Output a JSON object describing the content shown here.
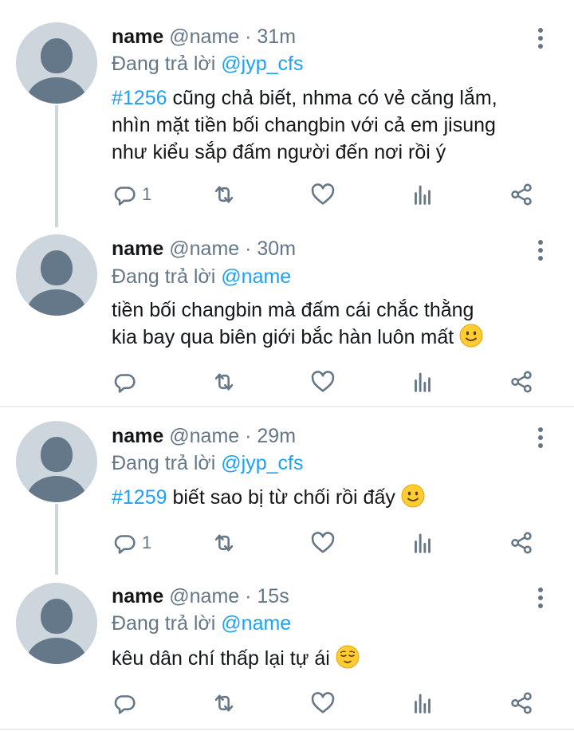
{
  "tweets": [
    {
      "name": "name",
      "meta": "@name · 31m",
      "replying_prefix": "Đang trả lời ",
      "replying_handle": "@jyp_cfs",
      "tag": "#1256",
      "text_line1": " cũng chả biết, nhma có vẻ căng lắm,",
      "text_line2": "nhìn mặt tiền bối changbin với cả em jisung",
      "text_line3": "như kiểu sắp đấm người đến nơi rồi ý",
      "reply_count": "1"
    },
    {
      "name": "name",
      "meta": "@name · 30m",
      "replying_prefix": "Đang trả lời ",
      "replying_handle": "@name",
      "text_line1": "tiền bối changbin mà đấm cái chắc thằng",
      "text_line2": "kia bay qua biên giới bắc hàn luôn mất",
      "emoji": "slightly-smiling-face",
      "reply_count": ""
    },
    {
      "name": "name",
      "meta": "@name · 29m",
      "replying_prefix": "Đang trả lời ",
      "replying_handle": "@jyp_cfs",
      "tag": "#1259",
      "text_line1": " biết sao bị từ chối rồi đấy",
      "emoji": "slightly-smiling-face",
      "reply_count": "1"
    },
    {
      "name": "name",
      "meta": "@name · 15s",
      "replying_prefix": "Đang trả lời ",
      "replying_handle": "@name",
      "text_line1": "kêu dân chí thấp lại tự ái",
      "emoji": "relieved-face",
      "reply_count": ""
    }
  ],
  "colors": {
    "link": "#1da1f2",
    "secondary": "#657786",
    "avatar_bg": "#cdd6dd",
    "avatar_fg": "#647889"
  },
  "icons": [
    "reply-icon",
    "retweet-icon",
    "like-icon",
    "analytics-icon",
    "share-icon",
    "more-icon"
  ]
}
